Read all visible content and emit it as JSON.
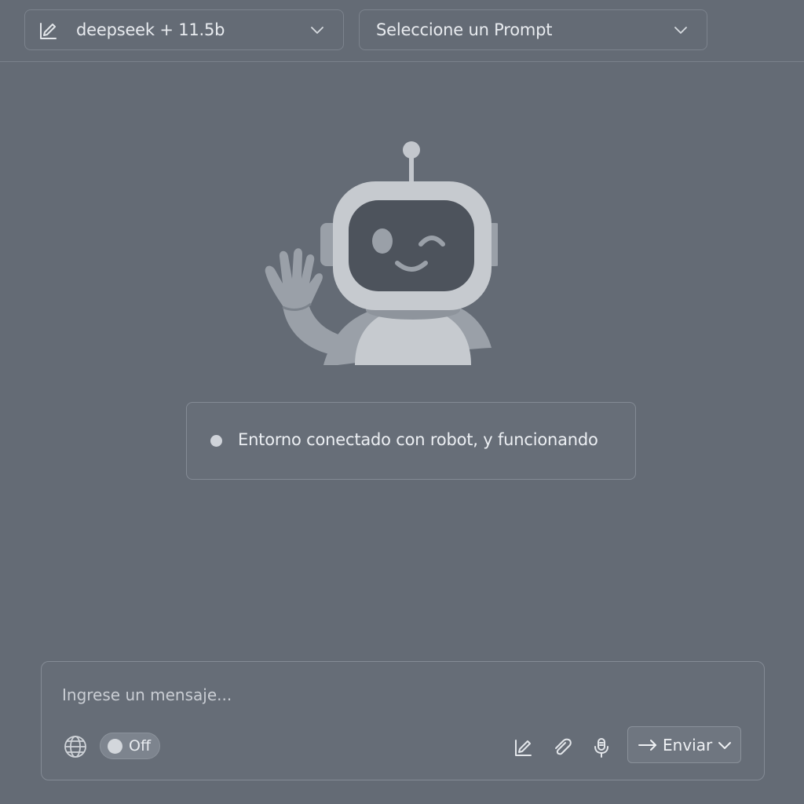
{
  "header": {
    "model_select": {
      "value": "deepseek + 11.5b",
      "icon": "edit-icon"
    },
    "prompt_select": {
      "value": "Seleccione un Prompt"
    }
  },
  "hero": {
    "illustration": "waving-robot",
    "status": {
      "text": "Entorno conectado con robot, y funcionando"
    }
  },
  "composer": {
    "placeholder": "Ingrese un mensaje...",
    "web_toggle": {
      "label": "Off",
      "state": "off"
    },
    "tools": [
      "globe-icon",
      "edit-icon",
      "paperclip-icon",
      "microphone-icon"
    ],
    "send_label": "Enviar"
  },
  "colors": {
    "background": "#646b75",
    "border": "#848b95",
    "text": "#e6e9ee",
    "robot_face": "#4d535c",
    "robot_body": "#c2c6cc"
  }
}
